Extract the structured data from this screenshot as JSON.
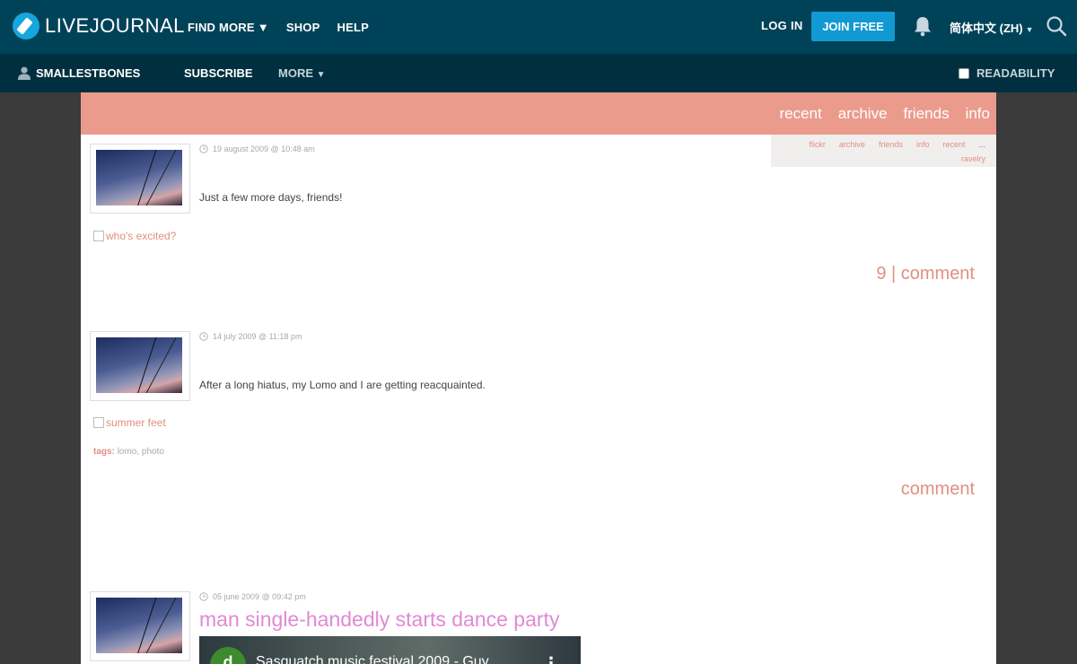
{
  "topbar": {
    "logo_text": "LIVEJOURNAL",
    "nav": [
      {
        "label": "FIND MORE",
        "caret": true
      },
      {
        "label": "SHOP",
        "caret": false
      },
      {
        "label": "HELP",
        "caret": false
      }
    ],
    "login_label": "LOG IN",
    "join_label": "JOIN FREE",
    "language": "简体中文 (ZH)",
    "bell_icon": "bell-icon",
    "search_icon": "search-icon"
  },
  "subbar": {
    "username": "SMALLESTBONES",
    "subscribe_label": "SUBSCRIBE",
    "more_label": "MORE",
    "readability_label": "READABILITY"
  },
  "journal": {
    "nav": [
      "recent",
      "archive",
      "friends",
      "info"
    ],
    "side_links": [
      "flickr",
      "archive",
      "friends",
      "info",
      "recent",
      "..."
    ],
    "side_link_extra": "ravelry",
    "entries": [
      {
        "date": "19 august 2009 @ 10:48 am",
        "text": "Just a few more days, friends!",
        "image_alt": "who's excited?",
        "comment": "9 | comment"
      },
      {
        "date": "14 july 2009 @ 11:18 pm",
        "text": "After a long hiatus, my Lomo and I are getting reacquainted.",
        "image_alt": "summer feet",
        "tags_label": "tags:",
        "tags": "lomo, photo",
        "comment": "comment"
      },
      {
        "date": "05 june 2009 @ 09:42 pm",
        "title": "man single-handedly starts dance party",
        "video_channel_letter": "d",
        "video_title": "Sasquatch music festival 2009 - Guy",
        "video_menu": "⋮"
      }
    ]
  },
  "colors": {
    "topbar": "#004359",
    "subbar": "#00303f",
    "join_button": "#1199d4",
    "journal_header": "#eb9b8c",
    "link": "#e1907f",
    "title": "#e189d5"
  }
}
